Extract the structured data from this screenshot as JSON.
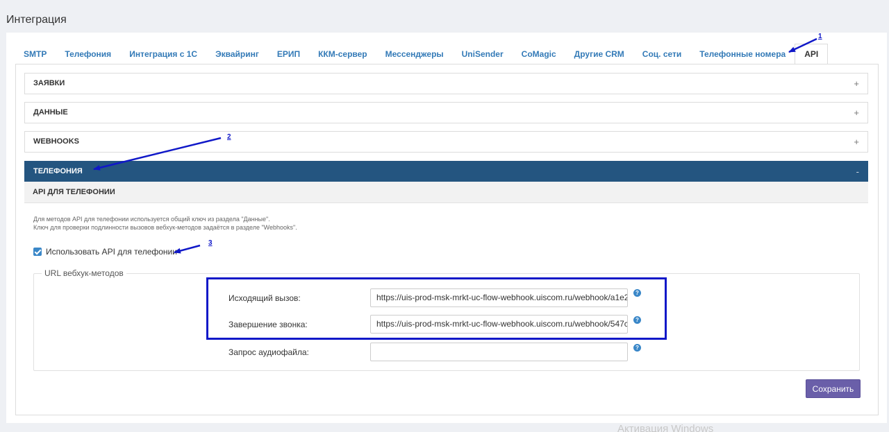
{
  "page": {
    "title": "Интеграция"
  },
  "tabs": [
    "SMTP",
    "Телефония",
    "Интеграция с 1С",
    "Эквайринг",
    "ЕРИП",
    "ККМ-сервер",
    "Мессенджеры",
    "UniSender",
    "CoMagic",
    "Другие CRM",
    "Соц. сети",
    "Телефонные номера",
    "API"
  ],
  "active_tab": "API",
  "accordion": [
    {
      "label": "ЗАЯВКИ",
      "toggle": "+"
    },
    {
      "label": "ДАННЫЕ",
      "toggle": "+"
    },
    {
      "label": "WEBHOOKS",
      "toggle": "+"
    },
    {
      "label": "ТЕЛЕФОНИЯ",
      "toggle": "-"
    }
  ],
  "telephony": {
    "subheader": "API ДЛЯ ТЕЛЕФОНИИ",
    "info_line1": "Для методов API для телефонии используется общий ключ из раздела \"Данные\".",
    "info_line2": "Ключ для проверки подлинности вызовов вебхук-методов задаётся в разделе \"Webhooks\".",
    "checkbox_label": "Использовать API для телефонии",
    "checkbox_checked": true,
    "fieldset_legend": "URL вебхук-методов",
    "fields": [
      {
        "label": "Исходящий вызов:",
        "value": "https://uis-prod-msk-mrkt-uc-flow-webhook.uiscom.ru/webhook/a1e2"
      },
      {
        "label": "Завершение звонка:",
        "value": "https://uis-prod-msk-mrkt-uc-flow-webhook.uiscom.ru/webhook/547c"
      },
      {
        "label": "Запрос аудиофайла:",
        "value": ""
      }
    ],
    "help_glyph": "?",
    "save_label": "Сохранить"
  },
  "annotations": [
    "1",
    "2",
    "3"
  ],
  "watermark": "Активация Windows",
  "colors": {
    "accent": "#245580",
    "link": "#337ab7",
    "button": "#6a5fa9",
    "annotation": "#1018c8"
  }
}
